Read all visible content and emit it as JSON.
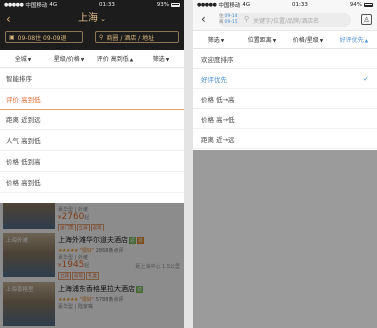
{
  "left": {
    "status": {
      "carrier": "中国移动",
      "network": "4G",
      "time": "01:33",
      "battery": "93%"
    },
    "header": {
      "back": "‹",
      "city": "上海",
      "dates": "09-08住 09-09退",
      "search_placeholder": "商圈 / 酒店 / 地址"
    },
    "filters": [
      {
        "label": "全城",
        "active": false
      },
      {
        "label": "星级/价格",
        "active": false
      },
      {
        "label": "评价 高到低",
        "active": true
      },
      {
        "label": "筛选",
        "active": false
      }
    ],
    "sort_options": [
      {
        "label": "智能排序",
        "selected": false
      },
      {
        "label": "评价 高到低",
        "selected": true
      },
      {
        "label": "距离 近到远",
        "selected": false
      },
      {
        "label": "人气 高到低",
        "selected": false
      },
      {
        "label": "价格 低到高",
        "selected": false
      },
      {
        "label": "价格 高到低",
        "selected": false
      }
    ],
    "hotels": [
      {
        "name": "",
        "stars": "",
        "good": "",
        "level": "豪华型 | 外滩",
        "price": "2760",
        "qi": "起",
        "badges": [
          "送门票",
          "立减",
          "返现"
        ],
        "distance": ""
      },
      {
        "name": "上海外滩华尔道夫酒店",
        "tags": [
          "返",
          "首"
        ],
        "stars": "★★★★★",
        "good": "\"很好\"",
        "reviews": "2868条点评",
        "level": "豪华型 | 外滩",
        "price": "1945",
        "qi": "起",
        "badges": [
          "立减",
          "返现",
          "礼盒"
        ],
        "distance": "距上海中心 1.5公里"
      },
      {
        "name": "上海浦东香格里拉大酒店",
        "tags": [
          "返"
        ],
        "stars": "★★★★★",
        "good": "\"很好\"",
        "reviews": "5788条点评",
        "level": "豪华型 | 陆家嘴",
        "price": "",
        "qi": "",
        "badges": [],
        "distance": ""
      }
    ]
  },
  "right": {
    "status": {
      "carrier": "中国移动",
      "network": "4G",
      "time": "01:33",
      "battery": "94%"
    },
    "header": {
      "back": "‹",
      "checkin_label": "住",
      "checkin": "09-14",
      "checkout_label": "离",
      "checkout": "09-15",
      "search_placeholder": "关键字/位置/品牌/酒店名"
    },
    "filters": [
      {
        "label": "筛选",
        "active": false
      },
      {
        "label": "位置距离",
        "active": false
      },
      {
        "label": "价格/星级",
        "active": false
      },
      {
        "label": "好评优先",
        "active": true
      }
    ],
    "sort_options": [
      {
        "label": "欢迎度排序",
        "selected": false
      },
      {
        "label": "好评优先",
        "selected": true
      },
      {
        "label": "价格 低→高",
        "selected": false
      },
      {
        "label": "价格 高→低",
        "selected": false
      },
      {
        "label": "距离 近→远",
        "selected": false
      }
    ]
  },
  "colors": {
    "gold": "#d9b97f",
    "orange": "#e36a31",
    "blue": "#4a90d9",
    "dark": "#1c1c1c"
  }
}
